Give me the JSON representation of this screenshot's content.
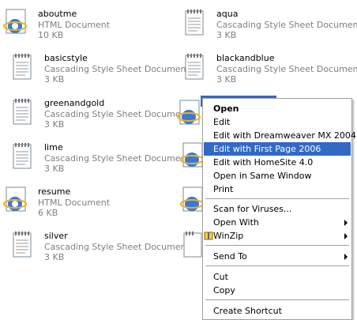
{
  "files": [
    {
      "name": "aboutme",
      "type": "HTML Document",
      "size": "10 KB",
      "icon": "ie-html-icon"
    },
    {
      "name": "aqua",
      "type": "Cascading Style Sheet Document",
      "size": "3 KB",
      "icon": "css-notepad-icon"
    },
    {
      "name": "basicstyle",
      "type": "Cascading Style Sheet Document",
      "size": "3 KB",
      "icon": "css-notepad-icon"
    },
    {
      "name": "blackandblue",
      "type": "Cascading Style Sheet Document",
      "size": "3 KB",
      "icon": "css-notepad-icon"
    },
    {
      "name": "greenandgold",
      "type": "Cascading Style Sheet Document",
      "size": "3 KB",
      "icon": "css-notepad-icon"
    },
    {
      "name": "lime",
      "type": "Cascading Style Sheet Document",
      "size": "3 KB",
      "icon": "css-notepad-icon"
    },
    {
      "name": "resume",
      "type": "HTML Document",
      "size": "6 KB",
      "icon": "ie-html-icon"
    },
    {
      "name": "silver",
      "type": "Cascading Style Sheet Document",
      "size": "3 KB",
      "icon": "css-notepad-icon"
    }
  ],
  "context_menu": {
    "items": [
      {
        "label": "Open"
      },
      {
        "label": "Edit"
      },
      {
        "label": "Edit with Dreamweaver MX 2004"
      },
      {
        "label": "Edit with First Page 2006"
      },
      {
        "label": "Edit with HomeSite 4.0"
      },
      {
        "label": "Open in Same Window"
      },
      {
        "label": "Print"
      },
      {
        "label": "Scan for Viruses..."
      },
      {
        "label": "Open With"
      },
      {
        "label": "WinZip"
      },
      {
        "label": "Send To"
      },
      {
        "label": "Cut"
      },
      {
        "label": "Copy"
      },
      {
        "label": "Create Shortcut"
      }
    ],
    "highlight_color": "#316ac5"
  }
}
